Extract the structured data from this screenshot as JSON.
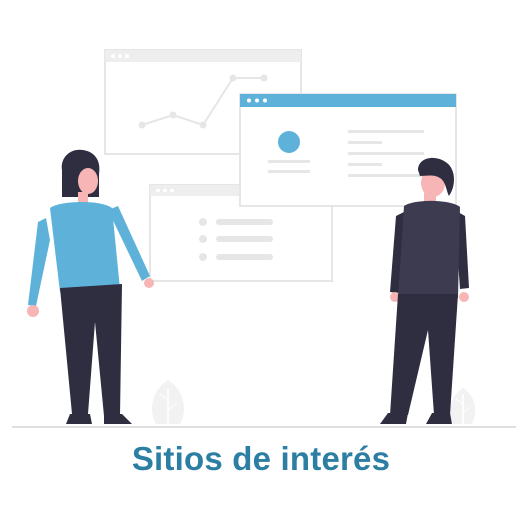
{
  "caption": "Sitios de interés",
  "colors": {
    "accent_blue": "#5eb2d9",
    "dark_navy": "#2f2e41",
    "skin": "#f7b6b5",
    "window_gray": "#e6e6e6",
    "window_line": "#ebebeb",
    "caption_blue": "#2c7ea3",
    "ground": "#cccccc"
  },
  "illustration": {
    "windows": [
      "line-chart-window",
      "profile-window",
      "list-window"
    ],
    "figures": [
      "woman-pointing",
      "man-standing"
    ],
    "plants": [
      "leaf-left",
      "leaf-right"
    ]
  }
}
